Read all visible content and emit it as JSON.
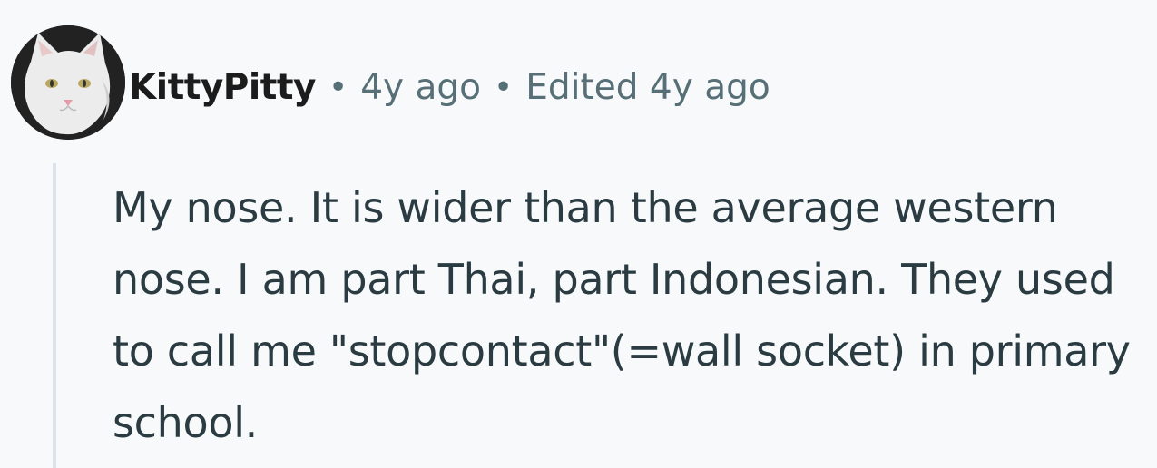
{
  "comment": {
    "author": "KittyPitty",
    "avatar_icon": "cat-avatar",
    "separator": "•",
    "posted": "4y ago",
    "edited": "Edited 4y ago",
    "body": "My nose. It is wider than the average western nose. I am part Thai, part Indonesian. They used to call me \"stopcontact\"(=wall socket) in primary school."
  },
  "colors": {
    "background": "#f8f9fb",
    "author_text": "#1c1c1c",
    "meta_text": "#576f76",
    "body_text": "#2a3c42",
    "thread_line": "#dce3ea"
  }
}
